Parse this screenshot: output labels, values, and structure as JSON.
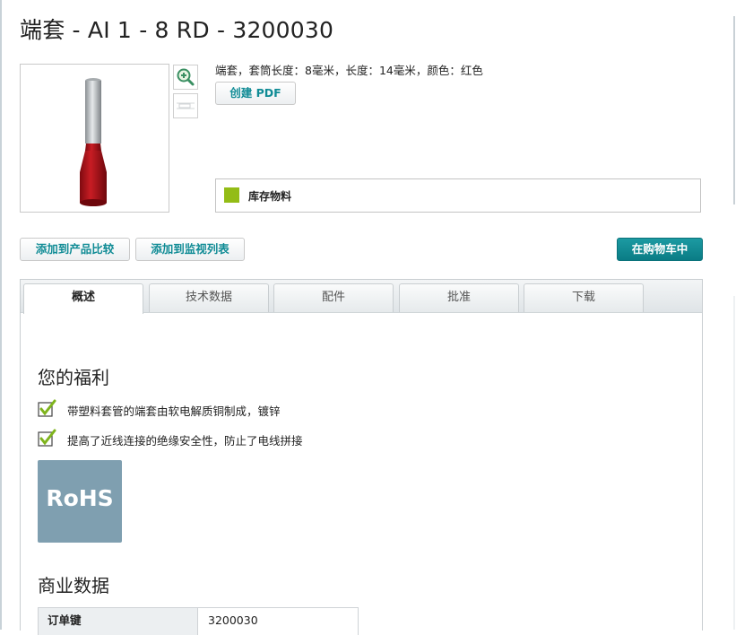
{
  "product": {
    "title": "端套 - AI 1 - 8 RD - 3200030",
    "description": "端套，套筒长度：8毫米，长度：14毫米，颜色：红色",
    "pdf_button": "创建 PDF",
    "stock_status": "库存物料",
    "stock_color": "#93bc16"
  },
  "gallery": {
    "zoom_icon": "zoom-in-icon",
    "alt_thumb_icon": "drawing-thumbnail-icon"
  },
  "actions": {
    "compare": "添加到产品比较",
    "watchlist": "添加到监视列表",
    "cart": "在购物车中"
  },
  "tabs": [
    {
      "label": "概述",
      "active": true
    },
    {
      "label": "技术数据",
      "active": false
    },
    {
      "label": "配件",
      "active": false
    },
    {
      "label": "批准",
      "active": false
    },
    {
      "label": "下载",
      "active": false
    }
  ],
  "overview": {
    "benefits_heading": "您的福利",
    "benefits": [
      "带塑料套管的端套由软电解质铜制成，镀锌",
      "提高了近线连接的绝缘安全性，防止了电线拼接"
    ],
    "rohs_label": "RoHS",
    "commercial_heading": "商业数据",
    "order_key_label": "订单键",
    "order_key_value": "3200030"
  },
  "colors": {
    "accent": "#0f8b95",
    "cart_button": "#0a7c85",
    "rohs_badge": "#7f9fb0"
  }
}
